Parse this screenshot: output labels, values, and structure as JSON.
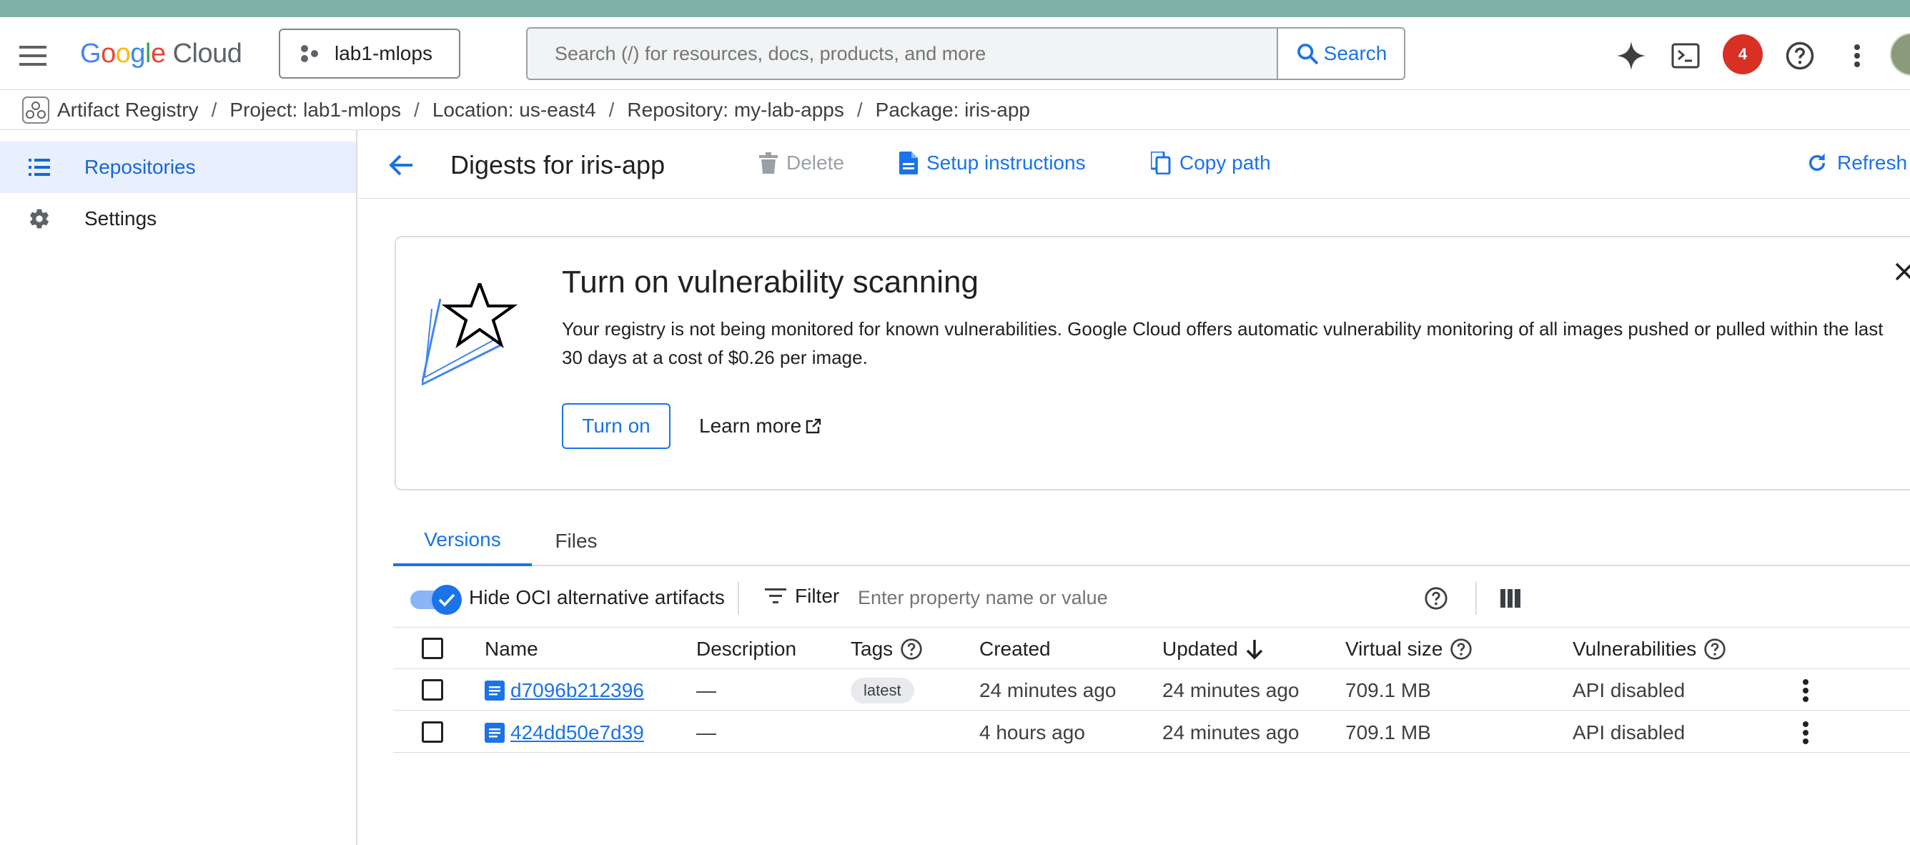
{
  "header": {
    "logo_google": "Google",
    "logo_cloud": "Cloud",
    "project": "lab1-mlops",
    "search_placeholder": "Search (/) for resources, docs, products, and more",
    "search_button": "Search",
    "notification_count": "4",
    "icons": [
      "menu-icon",
      "gemini-icon",
      "cloud-shell-icon",
      "help-icon",
      "more-vert-icon"
    ]
  },
  "breadcrumb": {
    "items": [
      "Artifact Registry",
      "Project: lab1-mlops",
      "Location: us-east4",
      "Repository: my-lab-apps",
      "Package: iris-app"
    ],
    "separator": "/"
  },
  "sidebar": {
    "items": [
      {
        "label": "Repositories",
        "icon": "list-icon",
        "active": true
      },
      {
        "label": "Settings",
        "icon": "gear-icon",
        "active": false
      }
    ]
  },
  "page": {
    "title": "Digests for iris-app",
    "actions": {
      "delete": "Delete",
      "setup": "Setup instructions",
      "copy_path": "Copy path",
      "refresh": "Refresh"
    }
  },
  "banner": {
    "title": "Turn on vulnerability scanning",
    "text": "Your registry is not being monitored for known vulnerabilities. Google Cloud offers automatic vulnerability monitoring of all images pushed or pulled within the last 30 days at a cost of $0.26 per image.",
    "turn_on": "Turn on",
    "learn_more": "Learn more"
  },
  "tabs": [
    {
      "label": "Versions",
      "active": true
    },
    {
      "label": "Files",
      "active": false
    }
  ],
  "filter": {
    "toggle_label": "Hide OCI alternative artifacts",
    "toggle_on": true,
    "filter_label": "Filter",
    "filter_placeholder": "Enter property name or value"
  },
  "table": {
    "columns": {
      "name": "Name",
      "description": "Description",
      "tags": "Tags",
      "created": "Created",
      "updated": "Updated",
      "virtual_size": "Virtual size",
      "vulnerabilities": "Vulnerabilities"
    },
    "sorted_by": "updated",
    "sort_direction": "descending",
    "rows": [
      {
        "name": "d7096b212396",
        "description": "—",
        "tag": "latest",
        "created": "24 minutes ago",
        "updated": "24 minutes ago",
        "virtual_size": "709.1 MB",
        "vulnerabilities": "API disabled"
      },
      {
        "name": "424dd50e7d39",
        "description": "—",
        "tag": "",
        "created": "4 hours ago",
        "updated": "24 minutes ago",
        "virtual_size": "709.1 MB",
        "vulnerabilities": "API disabled"
      }
    ]
  },
  "colors": {
    "accent": "#1a73e8",
    "active_nav_bg": "#e8f0fe",
    "notification": "#d93025",
    "border": "#dadce0"
  }
}
